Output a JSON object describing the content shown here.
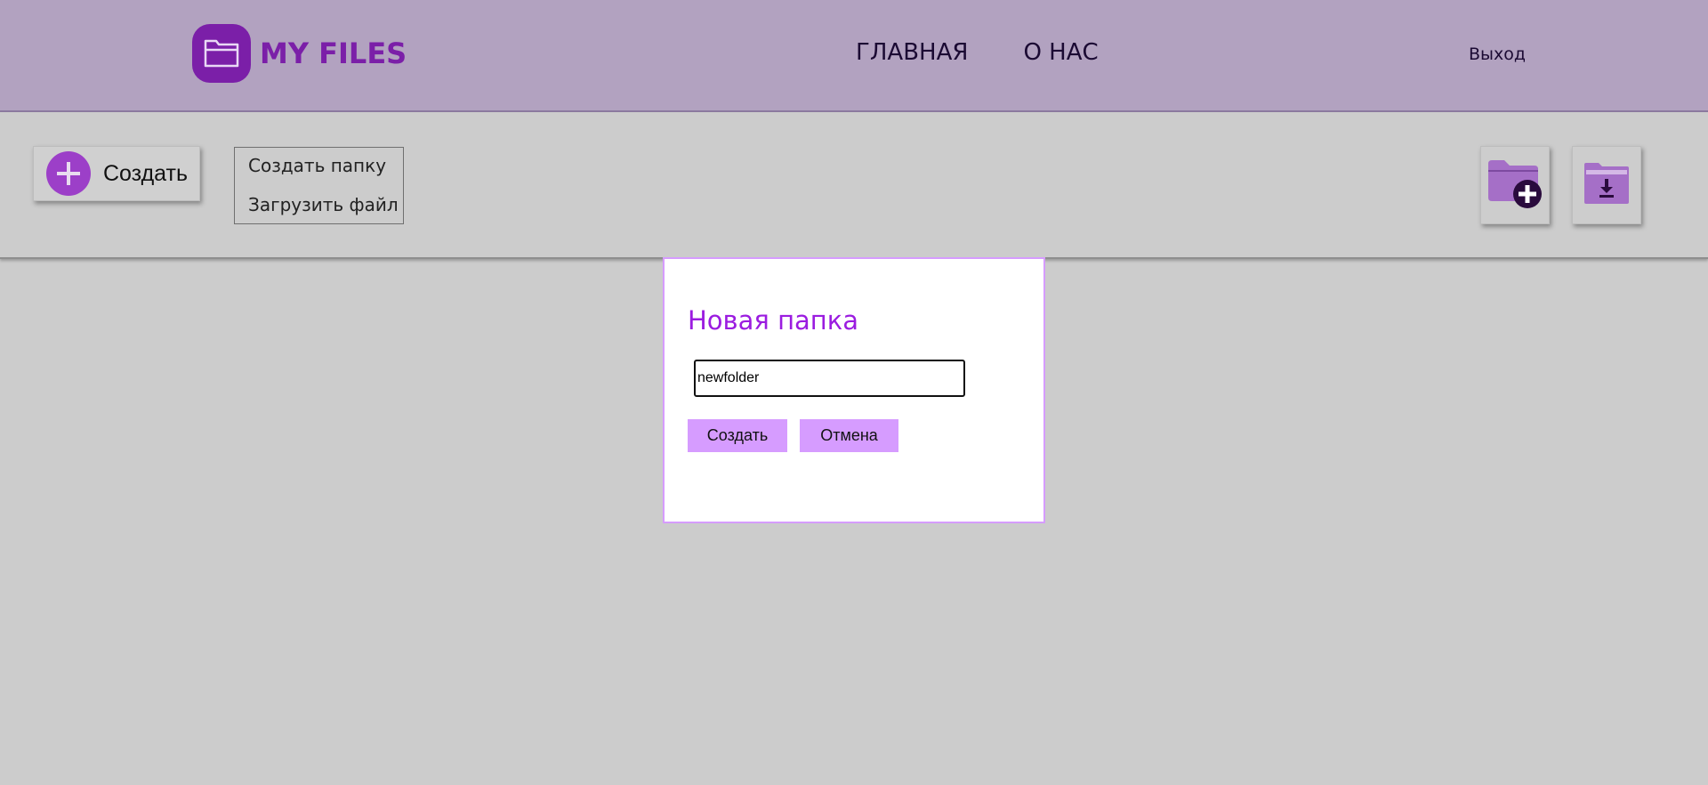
{
  "header": {
    "logo_text": "MY FILES",
    "nav": [
      "ГЛАВНАЯ",
      "О НАС"
    ],
    "logout": "Выход"
  },
  "toolbar": {
    "create_label": "Создать",
    "menu": [
      "Создать папку",
      "Загрузить файл"
    ],
    "icons": [
      "new-folder-icon",
      "upload-folder-icon"
    ]
  },
  "modal": {
    "title": "Новая папка",
    "input_value": "newfolder",
    "create_label": "Создать",
    "cancel_label": "Отмена"
  },
  "colors": {
    "header_bg": "#b2a2c0",
    "accent": "#7b1fa8",
    "modal_accent": "#d69cff",
    "title": "#9b1ce0",
    "page_bg": "#cccccc"
  }
}
